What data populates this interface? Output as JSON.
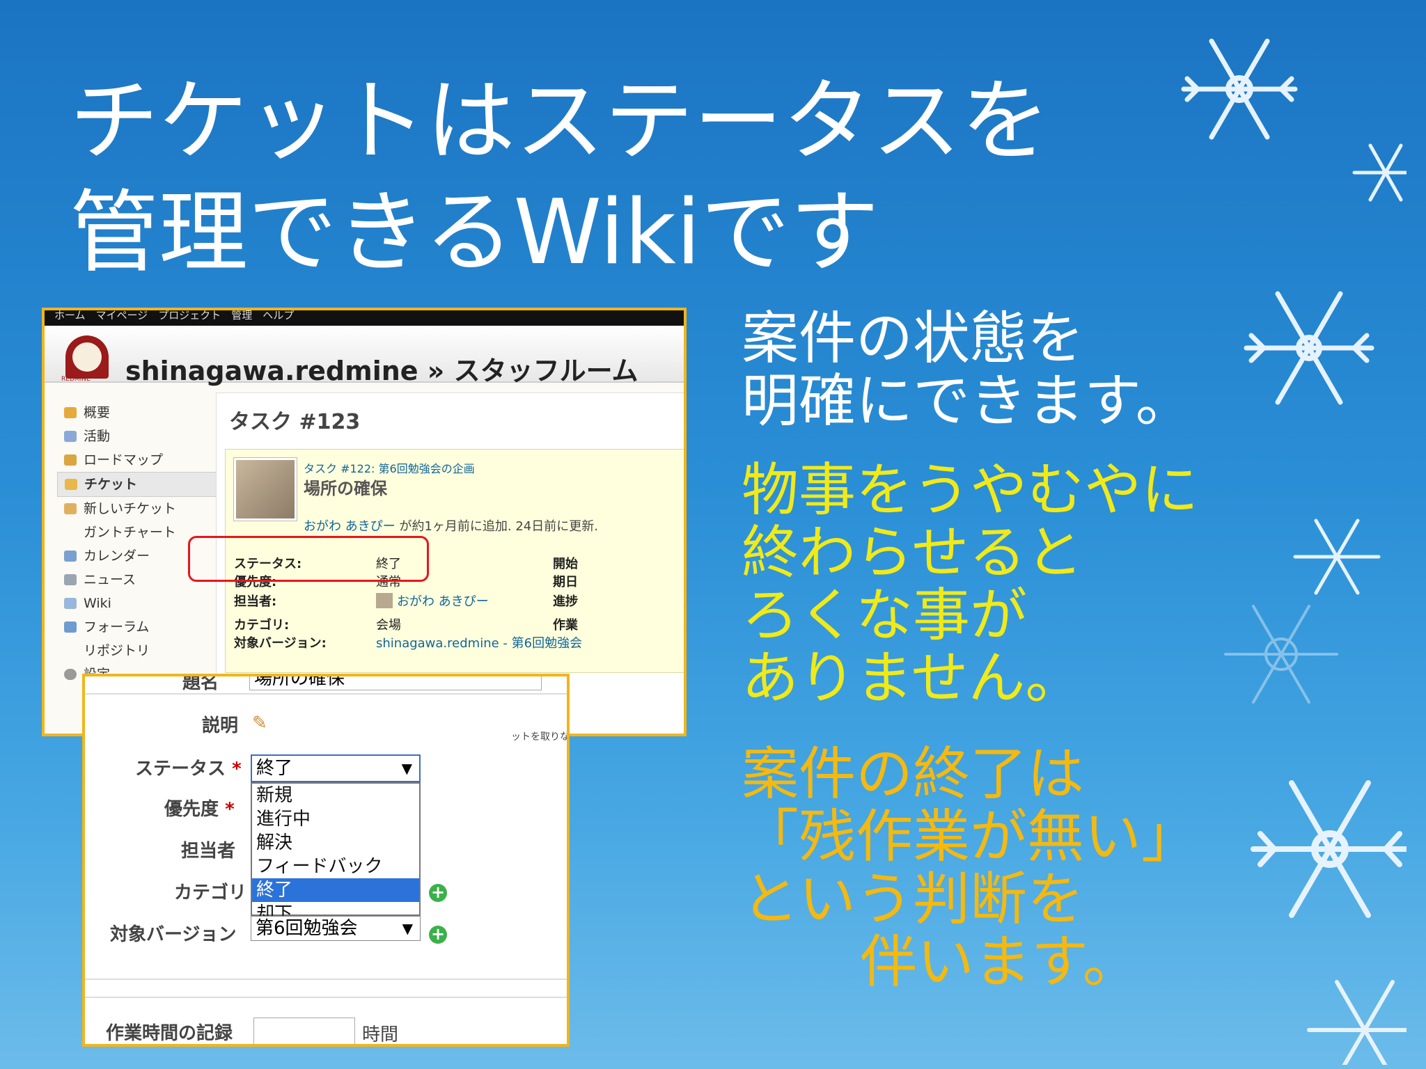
{
  "slide": {
    "title_line1": "チケットはステータスを",
    "title_line2": "管理できるWikiです",
    "text_white": [
      "案件の状態を",
      "明確にできます。"
    ],
    "text_yellow": [
      "物事をうやむやに",
      "終わらせると",
      "ろくな事が",
      "ありません。"
    ],
    "text_orange": [
      "案件の終了は",
      "「残作業が無い」",
      "という判断を",
      "伴います。"
    ],
    "colors": {
      "white": "#ffffff",
      "yellow": "#f1ea18",
      "orange": "#f5b90f",
      "background": "#2a8ed6",
      "frame": "#f2b51c",
      "highlight": "#e8151b"
    }
  },
  "redmine": {
    "top_menu": "ホーム　マイページ　プロジェクト　管理　ヘルプ",
    "logo_text": "REDMINE",
    "project_title": "shinagawa.redmine » スタッフルーム",
    "sidebar": [
      {
        "label": "概要",
        "icon": "overview-icon"
      },
      {
        "label": "活動",
        "icon": "activity-icon"
      },
      {
        "label": "ロードマップ",
        "icon": "roadmap-icon"
      },
      {
        "label": "チケット",
        "icon": "issues-icon",
        "selected": true
      },
      {
        "label": "新しいチケット",
        "icon": "new-issue-icon"
      },
      {
        "label": "ガントチャート",
        "icon": ""
      },
      {
        "label": "カレンダー",
        "icon": "calendar-icon"
      },
      {
        "label": "ニュース",
        "icon": "news-icon"
      },
      {
        "label": "Wiki",
        "icon": "wiki-icon"
      },
      {
        "label": "フォーラム",
        "icon": "forum-icon"
      },
      {
        "label": "リポジトリ",
        "icon": ""
      },
      {
        "label": "設定",
        "icon": "settings-icon"
      }
    ],
    "task_title": "タスク #123",
    "parent": "タスク #122: 第6回勉強会の企画",
    "subject": "場所の確保",
    "author_name": "おがわ あきぴー",
    "author_rest": " が約1ヶ月前に追加. 24日前に更新.",
    "attrs": {
      "status_label": "ステータス:",
      "status_value": "終了",
      "priority_label": "優先度:",
      "priority_value": "通常",
      "assignee_label": "担当者:",
      "assignee_value": "おがわ あきぴー",
      "category_label": "カテゴリ:",
      "category_value": "会場",
      "version_label": "対象バージョン:",
      "version_value": "shinagawa.redmine - 第6回勉強会",
      "right_col": [
        "開始",
        "期日",
        "進捗",
        "作業"
      ]
    }
  },
  "edit_form": {
    "subject_label": "題名",
    "subject_value": "場所の確保",
    "description_label": "説明",
    "status_label": "ステータス",
    "priority_label": "優先度",
    "assignee_label": "担当者",
    "category_label": "カテゴリ",
    "version_label": "対象バージョン",
    "required_mark": "*",
    "status_selected": "終了",
    "status_options": [
      "新規",
      "進行中",
      "解決",
      "フィードバック",
      "終了",
      "却下"
    ],
    "highlighted_option": "終了",
    "version_value": "第6回勉強会",
    "time_label": "作業時間の記録",
    "time_unit": "時間",
    "bg_text": "ットを取りながら場所を"
  }
}
